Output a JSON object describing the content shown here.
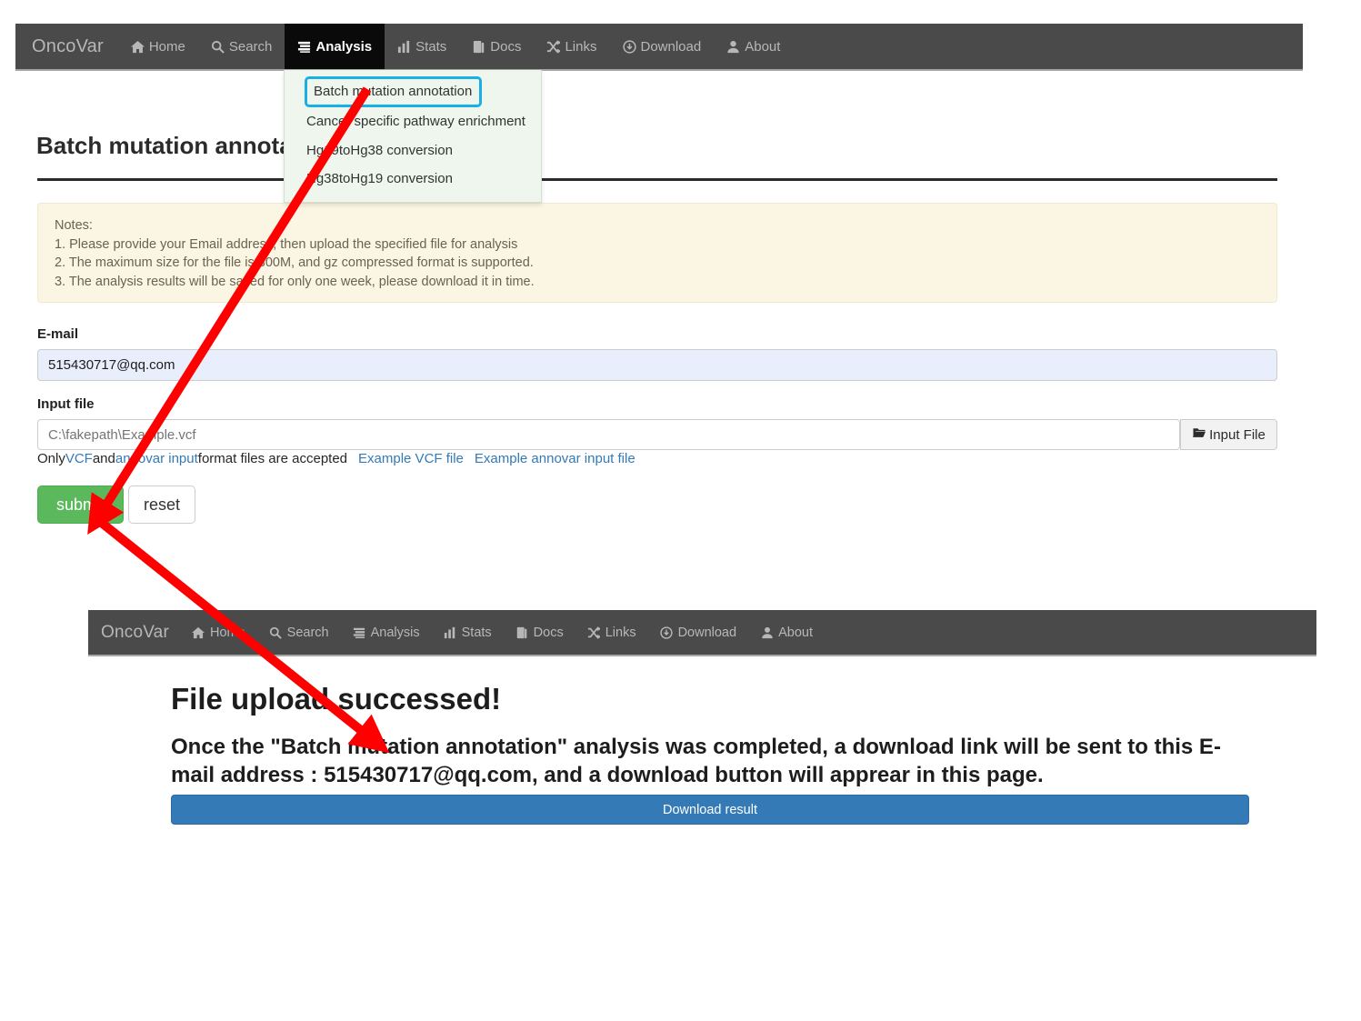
{
  "navbar": {
    "brand": "OncoVar",
    "items": [
      {
        "label": "Home",
        "icon": "home-icon"
      },
      {
        "label": "Search",
        "icon": "search-icon"
      },
      {
        "label": "Analysis",
        "icon": "analysis-icon",
        "active": true
      },
      {
        "label": "Stats",
        "icon": "bar-chart-icon"
      },
      {
        "label": "Docs",
        "icon": "docs-icon"
      },
      {
        "label": "Links",
        "icon": "shuffle-icon"
      },
      {
        "label": "Download",
        "icon": "download-circle-icon"
      },
      {
        "label": "About",
        "icon": "user-icon"
      }
    ]
  },
  "dropdown": {
    "items": [
      {
        "label": "Batch mutation annotation",
        "focused": true
      },
      {
        "label": "Cancer specific pathway enrichment"
      },
      {
        "label": "Hg19toHg38 conversion"
      },
      {
        "label": "Hg38toHg19 conversion"
      }
    ],
    "focus_color": "#19b0e6",
    "background": "#eef6ee"
  },
  "page": {
    "title": "Batch mutation annotat",
    "notes": [
      "Notes:",
      "1. Please provide your Email address, then upload the specified file for analysis",
      "2. The maximum size for the file is 300M, and gz compressed format is supported.",
      "3. The analysis results will be saved for only one week, please download it in time."
    ],
    "email": {
      "label": "E-mail",
      "value": "515430717@qq.com",
      "placeholder": "E-mail"
    },
    "input_file": {
      "label": "Input file",
      "value": "C:\\fakepath\\Example.vcf",
      "placeholder": "C:\\fakepath\\Example.vcf",
      "button_label": "Input File",
      "button_icon": "folder-open-icon"
    },
    "hint": {
      "prefix": "Only ",
      "link_vcf": "VCF",
      "middle": " and ",
      "link_annovar": "annovar input",
      "suffix": " format files are accepted",
      "link_example_vcf": "Example VCF file",
      "link_example_annovar": "Example annovar input file"
    },
    "submit_label": "submit",
    "reset_label": "reset"
  },
  "result": {
    "title": "File upload successed!",
    "message": "Once the \"Batch mutation annotation\" analysis was completed, a download link will be sent to this E-mail address : 515430717@qq.com, and a download button will apprear in this page.",
    "download_label": "Download result",
    "download_color": "#337ab7"
  },
  "colors": {
    "navbar_bg": "#4a4a4a",
    "navbar_active_bg": "#0a0a0a",
    "submit_green": "#5cb85c",
    "notes_bg": "#fbf5e3",
    "email_bg": "#e8eefb",
    "annotation_arrow": "#ff0000"
  }
}
